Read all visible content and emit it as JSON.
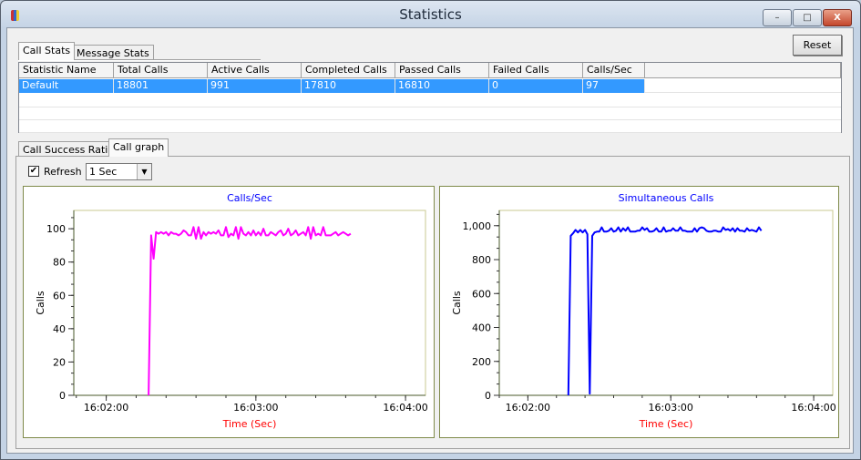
{
  "window": {
    "title": "Statistics",
    "minimize": "–",
    "maximize": "□",
    "close": "X"
  },
  "top_tabs": [
    {
      "label": "Call Stats",
      "active": true
    },
    {
      "label": "Message Stats",
      "active": false
    }
  ],
  "reset_label": "Reset",
  "table": {
    "columns": [
      "Statistic Name",
      "Total Calls",
      "Active Calls",
      "Completed Calls",
      "Passed Calls",
      "Failed Calls",
      "Calls/Sec"
    ],
    "rows": [
      [
        "Default",
        "18801",
        "991",
        "17810",
        "16810",
        "0",
        "97"
      ]
    ]
  },
  "bottom_tabs": [
    {
      "label": "Call Success Ratio",
      "active": false
    },
    {
      "label": "Call graph",
      "active": true
    }
  ],
  "refresh": {
    "label": "Refresh",
    "checked": true,
    "interval": "1 Sec"
  },
  "colors": {
    "selection": "#3399ff",
    "title_text": "#0000ff",
    "axis_label": "#ff0000",
    "series1": "#ff00ff",
    "series2": "#0000ff"
  },
  "chart_data": [
    {
      "type": "line",
      "title": "Calls/Sec",
      "xlabel": "Time (Sec)",
      "ylabel": "Calls",
      "x_unit": "seconds after 16:02:00",
      "x_start": 17,
      "x_step": 1,
      "xlim": [
        -13,
        128
      ],
      "ylim": [
        0,
        111
      ],
      "y_ticks": [
        {
          "v": 0,
          "l": "0"
        },
        {
          "v": 20,
          "l": "20"
        },
        {
          "v": 40,
          "l": "40"
        },
        {
          "v": 60,
          "l": "60"
        },
        {
          "v": 80,
          "l": "80"
        },
        {
          "v": 100,
          "l": "100"
        }
      ],
      "x_ticks": [
        {
          "v": 0,
          "l": "16:02:00"
        },
        {
          "v": 60,
          "l": "16:03:00"
        },
        {
          "v": 120,
          "l": "16:04:00"
        }
      ],
      "color": "#ff00ff",
      "values": [
        0,
        96,
        82,
        98,
        97,
        98,
        97,
        98,
        96,
        98,
        97,
        97,
        96,
        97,
        99,
        98,
        96,
        96,
        101,
        94,
        101,
        94,
        98,
        96,
        98,
        97,
        98,
        97,
        99,
        96,
        96,
        101,
        95,
        97,
        96,
        101,
        94,
        101,
        97,
        96,
        98,
        96,
        99,
        96,
        98,
        96,
        100,
        96,
        96,
        98,
        97,
        96,
        98,
        99,
        96,
        97,
        100,
        96,
        97,
        99,
        96,
        97,
        98,
        96,
        101,
        94,
        101,
        96,
        97,
        96,
        101,
        96,
        96,
        96,
        97,
        98,
        96,
        97,
        98,
        97,
        96,
        97
      ]
    },
    {
      "type": "line",
      "title": "Simultaneous Calls",
      "xlabel": "Time (Sec)",
      "ylabel": "Calls",
      "x_unit": "seconds after 16:02:00",
      "x_start": 17,
      "x_step": 1,
      "xlim": [
        -12,
        128
      ],
      "ylim": [
        0,
        1090
      ],
      "y_ticks": [
        {
          "v": 0,
          "l": "0"
        },
        {
          "v": 200,
          "l": "200"
        },
        {
          "v": 400,
          "l": "400"
        },
        {
          "v": 600,
          "l": "600"
        },
        {
          "v": 800,
          "l": "800"
        },
        {
          "v": 1000,
          "l": "1,000"
        }
      ],
      "x_ticks": [
        {
          "v": 0,
          "l": "16:02:00"
        },
        {
          "v": 60,
          "l": "16:03:00"
        },
        {
          "v": 120,
          "l": "16:04:00"
        }
      ],
      "color": "#0000ff",
      "values": [
        0,
        940,
        955,
        975,
        960,
        975,
        960,
        975,
        950,
        10,
        940,
        960,
        965,
        965,
        990,
        965,
        965,
        970,
        985,
        965,
        970,
        990,
        965,
        985,
        970,
        990,
        965,
        965,
        965,
        970,
        970,
        990,
        975,
        985,
        965,
        965,
        970,
        985,
        965,
        965,
        990,
        965,
        970,
        970,
        985,
        970,
        970,
        990,
        970,
        970,
        965,
        965,
        965,
        985,
        965,
        985,
        990,
        985,
        970,
        965,
        965,
        970,
        970,
        965,
        965,
        990,
        975,
        980,
        970,
        985,
        965,
        985,
        970,
        970,
        965,
        985,
        970,
        975,
        970,
        965,
        990,
        970
      ]
    }
  ]
}
